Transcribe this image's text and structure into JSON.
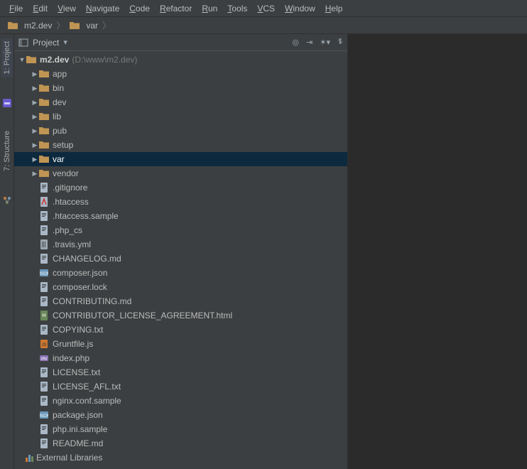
{
  "menu": {
    "items": [
      "File",
      "Edit",
      "View",
      "Navigate",
      "Code",
      "Refactor",
      "Run",
      "Tools",
      "VCS",
      "Window",
      "Help"
    ]
  },
  "breadcrumb": {
    "items": [
      "m2.dev",
      "var"
    ]
  },
  "leftTabs": {
    "project": "1: Project",
    "structure": "7: Structure"
  },
  "projectPanel": {
    "title": "Project"
  },
  "tree": {
    "root": {
      "name": "m2.dev",
      "path": "(D:\\www\\m2.dev)"
    },
    "folders": [
      "app",
      "bin",
      "dev",
      "lib",
      "pub",
      "setup",
      "var",
      "vendor"
    ],
    "selected": "var",
    "files": [
      {
        "name": ".gitignore",
        "t": "txt"
      },
      {
        "name": ".htaccess",
        "t": "ht"
      },
      {
        "name": ".htaccess.sample",
        "t": "txt"
      },
      {
        "name": ".php_cs",
        "t": "txt"
      },
      {
        "name": ".travis.yml",
        "t": "yml"
      },
      {
        "name": "CHANGELOG.md",
        "t": "txt"
      },
      {
        "name": "composer.json",
        "t": "json"
      },
      {
        "name": "composer.lock",
        "t": "txt"
      },
      {
        "name": "CONTRIBUTING.md",
        "t": "txt"
      },
      {
        "name": "CONTRIBUTOR_LICENSE_AGREEMENT.html",
        "t": "html"
      },
      {
        "name": "COPYING.txt",
        "t": "txt"
      },
      {
        "name": "Gruntfile.js",
        "t": "js"
      },
      {
        "name": "index.php",
        "t": "php"
      },
      {
        "name": "LICENSE.txt",
        "t": "txt"
      },
      {
        "name": "LICENSE_AFL.txt",
        "t": "txt"
      },
      {
        "name": "nginx.conf.sample",
        "t": "txt"
      },
      {
        "name": "package.json",
        "t": "json"
      },
      {
        "name": "php.ini.sample",
        "t": "txt"
      },
      {
        "name": "README.md",
        "t": "txt"
      }
    ],
    "extLib": "External Libraries"
  }
}
